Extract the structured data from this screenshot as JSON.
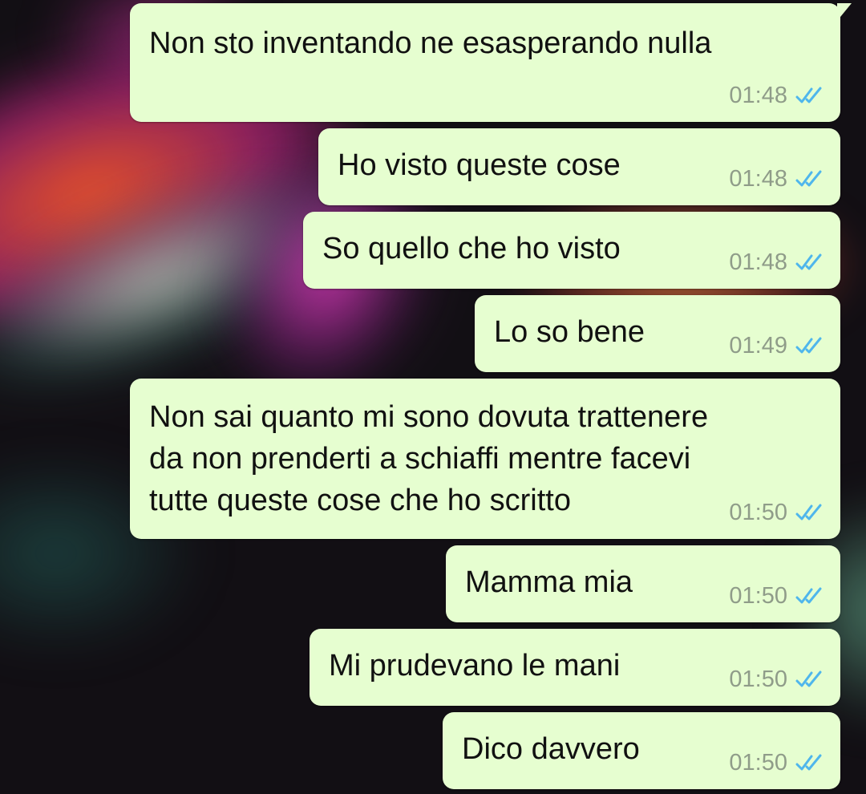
{
  "chat": {
    "messages": [
      {
        "text": "Non sto inventando ne esasperando nulla",
        "time": "01:48",
        "status_icon": "double-check-read-icon"
      },
      {
        "text": "Ho visto queste cose",
        "time": "01:48",
        "status_icon": "double-check-read-icon"
      },
      {
        "text": "So quello che ho visto",
        "time": "01:48",
        "status_icon": "double-check-read-icon"
      },
      {
        "text": "Lo so bene",
        "time": "01:49",
        "status_icon": "double-check-read-icon"
      },
      {
        "text": "Non sai quanto mi sono dovuta trattenere\nda non prenderti a schiaffi mentre facevi\ntutte queste cose che ho scritto",
        "time": "01:50",
        "status_icon": "double-check-read-icon"
      },
      {
        "text": "Mamma mia",
        "time": "01:50",
        "status_icon": "double-check-read-icon"
      },
      {
        "text": "Mi prudevano le mani",
        "time": "01:50",
        "status_icon": "double-check-read-icon"
      },
      {
        "text": "Dico davvero",
        "time": "01:50",
        "status_icon": "double-check-read-icon"
      }
    ]
  },
  "colors": {
    "outgoing_bubble": "#e6fed0",
    "timestamp": "#8f9c89",
    "read_tick": "#4fb6ec"
  }
}
